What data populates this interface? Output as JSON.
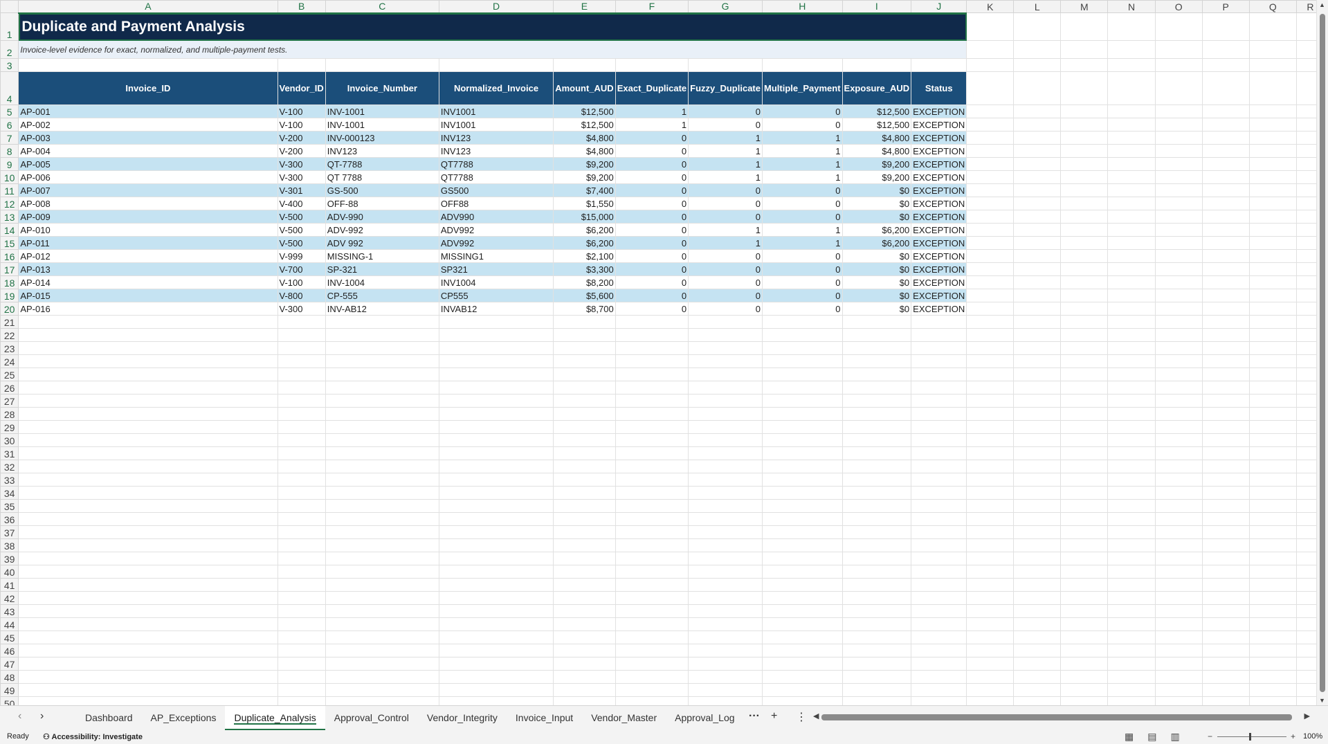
{
  "columns": [
    "A",
    "B",
    "C",
    "D",
    "E",
    "F",
    "G",
    "H",
    "I",
    "J",
    "K",
    "L",
    "M",
    "N",
    "O",
    "P",
    "Q",
    "R"
  ],
  "rows": {
    "first": 1,
    "last": 50
  },
  "sheet": {
    "title": "Duplicate and Payment Analysis",
    "subtitle": "Invoice-level evidence for exact, normalized, and multiple-payment tests.",
    "headers": [
      "Invoice_ID",
      "Vendor_ID",
      "Invoice_Number",
      "Normalized_Invoice",
      "Amount_AUD",
      "Exact_Duplicate",
      "Fuzzy_Duplicate",
      "Multiple_Payment",
      "Exposure_AUD",
      "Status"
    ],
    "rows": [
      [
        "AP-001",
        "V-100",
        "INV-1001",
        "INV1001",
        "$12,500",
        "1",
        "0",
        "0",
        "$12,500",
        "EXCEPTION"
      ],
      [
        "AP-002",
        "V-100",
        "INV-1001",
        "INV1001",
        "$12,500",
        "1",
        "0",
        "0",
        "$12,500",
        "EXCEPTION"
      ],
      [
        "AP-003",
        "V-200",
        "INV-000123",
        "INV123",
        "$4,800",
        "0",
        "1",
        "1",
        "$4,800",
        "EXCEPTION"
      ],
      [
        "AP-004",
        "V-200",
        "INV123",
        "INV123",
        "$4,800",
        "0",
        "1",
        "1",
        "$4,800",
        "EXCEPTION"
      ],
      [
        "AP-005",
        "V-300",
        "QT-7788",
        "QT7788",
        "$9,200",
        "0",
        "1",
        "1",
        "$9,200",
        "EXCEPTION"
      ],
      [
        "AP-006",
        "V-300",
        "QT 7788",
        "QT7788",
        "$9,200",
        "0",
        "1",
        "1",
        "$9,200",
        "EXCEPTION"
      ],
      [
        "AP-007",
        "V-301",
        "GS-500",
        "GS500",
        "$7,400",
        "0",
        "0",
        "0",
        "$0",
        "EXCEPTION"
      ],
      [
        "AP-008",
        "V-400",
        "OFF-88",
        "OFF88",
        "$1,550",
        "0",
        "0",
        "0",
        "$0",
        "EXCEPTION"
      ],
      [
        "AP-009",
        "V-500",
        "ADV-990",
        "ADV990",
        "$15,000",
        "0",
        "0",
        "0",
        "$0",
        "EXCEPTION"
      ],
      [
        "AP-010",
        "V-500",
        "ADV-992",
        "ADV992",
        "$6,200",
        "0",
        "1",
        "1",
        "$6,200",
        "EXCEPTION"
      ],
      [
        "AP-011",
        "V-500",
        "ADV 992",
        "ADV992",
        "$6,200",
        "0",
        "1",
        "1",
        "$6,200",
        "EXCEPTION"
      ],
      [
        "AP-012",
        "V-999",
        "MISSING-1",
        "MISSING1",
        "$2,100",
        "0",
        "0",
        "0",
        "$0",
        "EXCEPTION"
      ],
      [
        "AP-013",
        "V-700",
        "SP-321",
        "SP321",
        "$3,300",
        "0",
        "0",
        "0",
        "$0",
        "EXCEPTION"
      ],
      [
        "AP-014",
        "V-100",
        "INV-1004",
        "INV1004",
        "$8,200",
        "0",
        "0",
        "0",
        "$0",
        "EXCEPTION"
      ],
      [
        "AP-015",
        "V-800",
        "CP-555",
        "CP555",
        "$5,600",
        "0",
        "0",
        "0",
        "$0",
        "EXCEPTION"
      ],
      [
        "AP-016",
        "V-300",
        "INV-AB12",
        "INVAB12",
        "$8,700",
        "0",
        "0",
        "0",
        "$0",
        "EXCEPTION"
      ]
    ]
  },
  "tabs": [
    "Dashboard",
    "AP_Exceptions",
    "Duplicate_Analysis",
    "Approval_Control",
    "Vendor_Integrity",
    "Invoice_Input",
    "Vendor_Master",
    "Approval_Log"
  ],
  "active_tab": "Duplicate_Analysis",
  "status": {
    "ready": "Ready",
    "accessibility": "Accessibility: Investigate",
    "zoom": "100%"
  },
  "icons": {
    "more_tabs": "ellipsis-icon",
    "add_sheet": "plus-icon",
    "options": "vertical-ellipsis-icon"
  }
}
